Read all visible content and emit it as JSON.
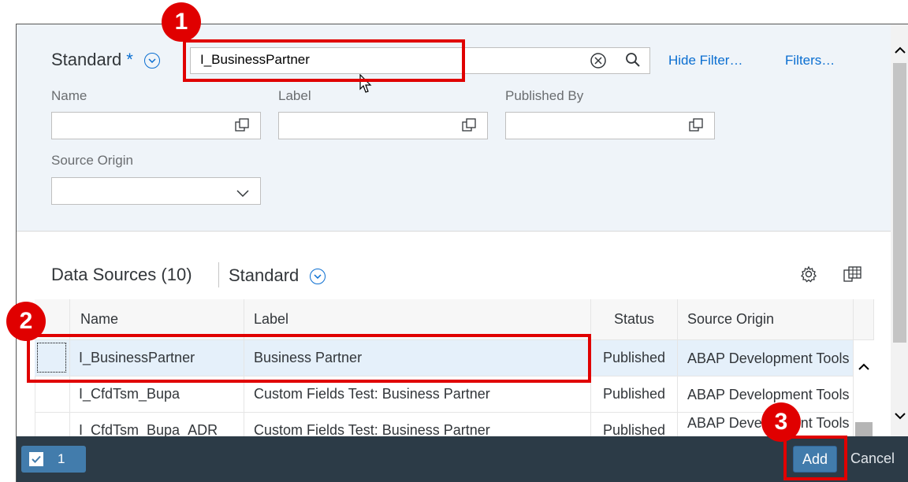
{
  "filter_bar": {
    "variant_name": "Standard",
    "variant_modified_marker": "*",
    "search_value": "I_BusinessPartner",
    "hide_filter_label": "Hide Filter…",
    "filters_label": "Filters…",
    "fields": [
      {
        "label": "Name",
        "value": ""
      },
      {
        "label": "Label",
        "value": ""
      },
      {
        "label": "Published By",
        "value": ""
      },
      {
        "label": "Source Origin",
        "value": ""
      }
    ]
  },
  "table": {
    "title": "Data Sources (10)",
    "variant_name": "Standard",
    "columns": [
      "Name",
      "Label",
      "Status",
      "Source Origin"
    ],
    "rows": [
      {
        "name": "I_BusinessPartner",
        "label": "Business Partner",
        "status": "Published",
        "origin": "ABAP Development Tools",
        "selected": true
      },
      {
        "name": "I_CfdTsm_Bupa",
        "label": "Custom Fields Test: Business Partner",
        "status": "Published",
        "origin": "ABAP Development Tools",
        "selected": false
      },
      {
        "name": "I_CfdTsm_Bupa_ADR",
        "label": "Custom Fields Test: Business Partner",
        "status": "Published",
        "origin": "ABAP Development Tools",
        "selected": false
      }
    ]
  },
  "footer": {
    "selected_count": "1",
    "add_label": "Add",
    "cancel_label": "Cancel"
  },
  "annotations": {
    "badge_1": "1",
    "badge_2": "2",
    "badge_3": "3"
  },
  "colors": {
    "accent": "#0a6ed1",
    "highlight": "#e00000",
    "footer": "#2c3b47",
    "button": "#427cac"
  }
}
